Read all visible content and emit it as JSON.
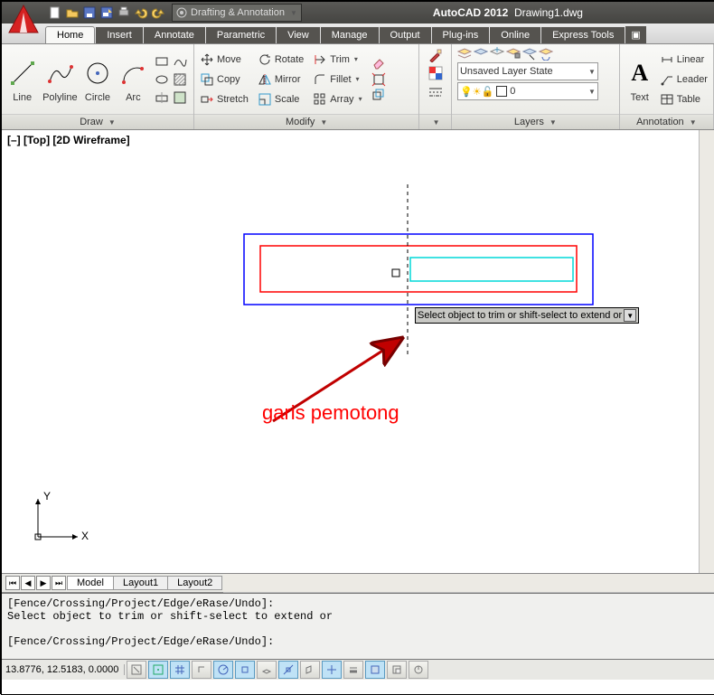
{
  "app": {
    "name": "AutoCAD 2012",
    "doc": "Drawing1.dwg"
  },
  "workspace": {
    "label": "Drafting & Annotation"
  },
  "tabs": [
    "Home",
    "Insert",
    "Annotate",
    "Parametric",
    "View",
    "Manage",
    "Output",
    "Plug-ins",
    "Online",
    "Express Tools"
  ],
  "active_tab": "Home",
  "panels": {
    "draw": {
      "title": "Draw",
      "items": {
        "line": "Line",
        "polyline": "Polyline",
        "circle": "Circle",
        "arc": "Arc"
      }
    },
    "modify": {
      "title": "Modify",
      "rows": {
        "move": "Move",
        "copy": "Copy",
        "stretch": "Stretch",
        "rotate": "Rotate",
        "mirror": "Mirror",
        "scale": "Scale",
        "trim": "Trim",
        "fillet": "Fillet",
        "array": "Array"
      }
    },
    "layers": {
      "title": "Layers",
      "state": "Unsaved Layer State",
      "current": "0"
    },
    "annotation": {
      "title": "Annotation",
      "text": "Text",
      "linear": "Linear",
      "leader": "Leader",
      "table": "Table"
    }
  },
  "view_label": "[–] [Top] [2D Wireframe]",
  "tooltip": "Select object to trim or shift-select to extend or",
  "annotation_text": "garis pemotong",
  "layouts": {
    "model": "Model",
    "l1": "Layout1",
    "l2": "Layout2"
  },
  "cmd": {
    "l1": "[Fence/Crossing/Project/Edge/eRase/Undo]:",
    "l2": "Select object to trim or shift-select to extend or",
    "l3": "",
    "l4": "[Fence/Crossing/Project/Edge/eRase/Undo]:"
  },
  "status": {
    "coords": "13.8776, 12.5183, 0.0000"
  },
  "axes": {
    "x": "X",
    "y": "Y"
  }
}
